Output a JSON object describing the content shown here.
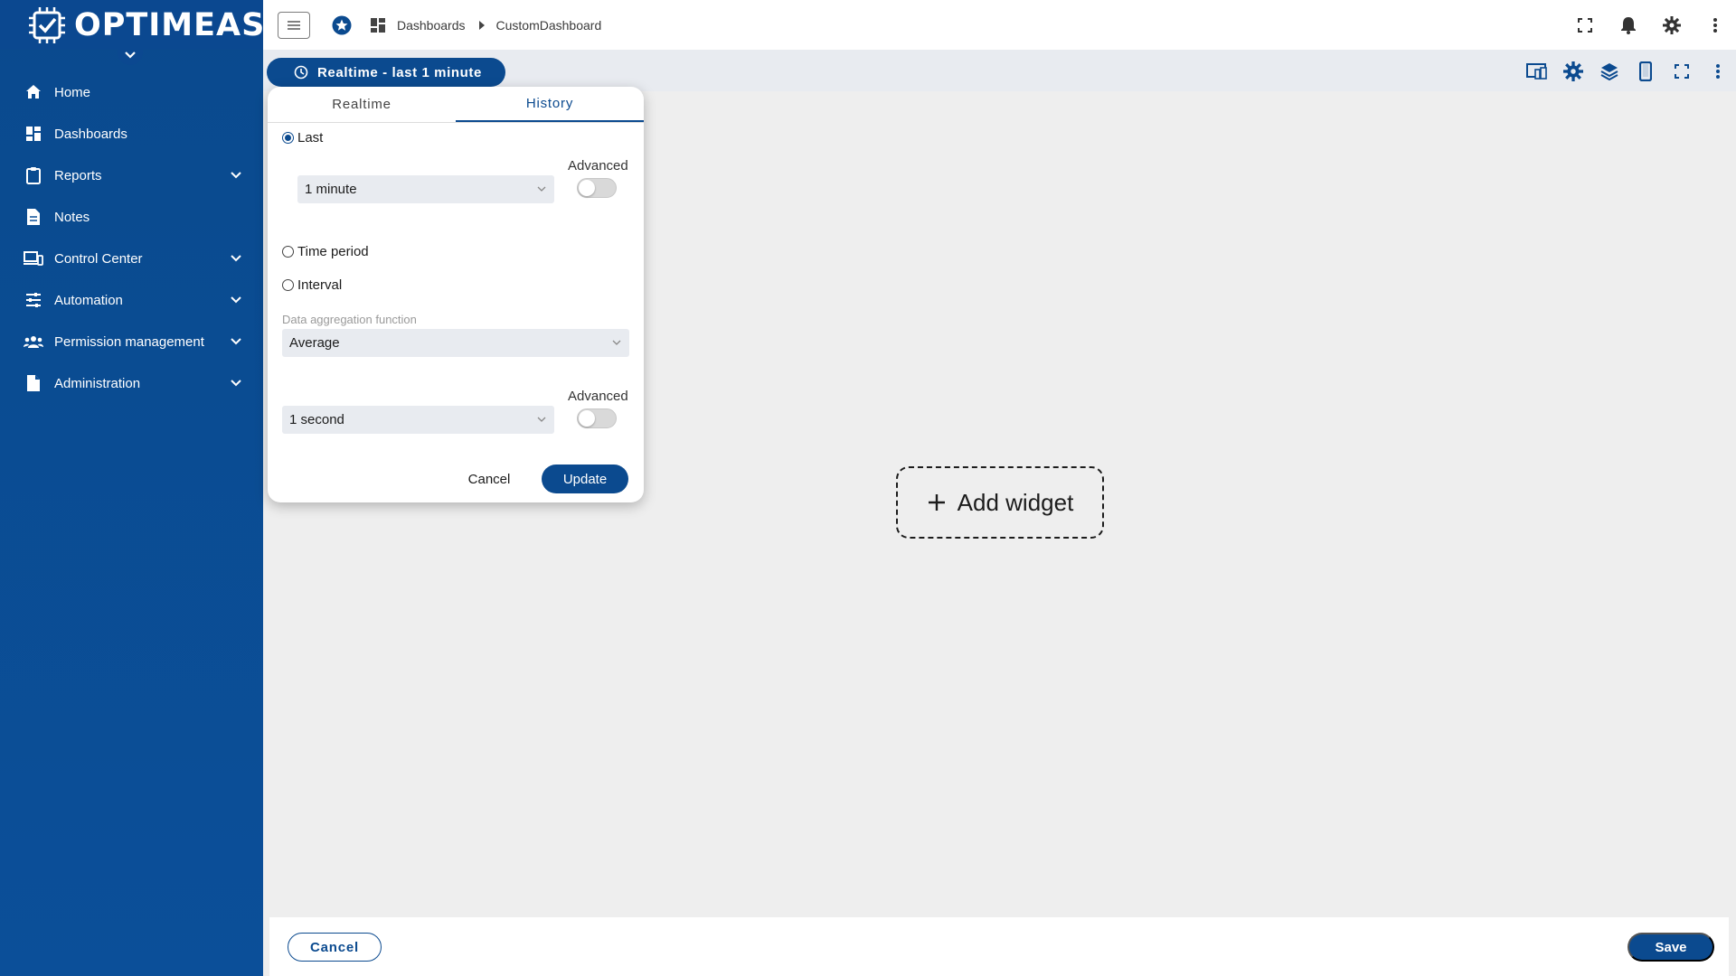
{
  "brand": {
    "logo_text": "OPTIMEAS"
  },
  "sidebar": {
    "items": [
      {
        "label": "Home",
        "icon": "home-icon",
        "expandable": false
      },
      {
        "label": "Dashboards",
        "icon": "dashboard-icon",
        "expandable": false
      },
      {
        "label": "Reports",
        "icon": "clipboard-icon",
        "expandable": true
      },
      {
        "label": "Notes",
        "icon": "note-icon",
        "expandable": false
      },
      {
        "label": "Control Center",
        "icon": "devices-icon",
        "expandable": true
      },
      {
        "label": "Automation",
        "icon": "sliders-icon",
        "expandable": true
      },
      {
        "label": "Permission management",
        "icon": "users-icon",
        "expandable": true
      },
      {
        "label": "Administration",
        "icon": "document-icon",
        "expandable": true
      }
    ]
  },
  "topbar": {
    "breadcrumb": [
      "Dashboards",
      "CustomDashboard"
    ]
  },
  "subbar": {
    "realtime_label": "Realtime - last 1 minute"
  },
  "popup": {
    "tabs": [
      {
        "label": "Realtime",
        "active": false
      },
      {
        "label": "History",
        "active": true
      }
    ],
    "last_label": "Last",
    "last_value": "1 minute",
    "advanced_label": "Advanced",
    "time_period_label": "Time period",
    "interval_label": "Interval",
    "aggregation_hint": "Data aggregation function",
    "aggregation_value": "Average",
    "advanced_label_2": "Advanced",
    "grouping_value": "1 second",
    "cancel_label": "Cancel",
    "update_label": "Update"
  },
  "canvas": {
    "add_widget_label": "Add widget"
  },
  "footer": {
    "cancel_label": "Cancel",
    "save_label": "Save"
  },
  "colors": {
    "primary": "#0b4a8f",
    "sidebar": "#0b4f99",
    "background": "#eeeeee"
  }
}
